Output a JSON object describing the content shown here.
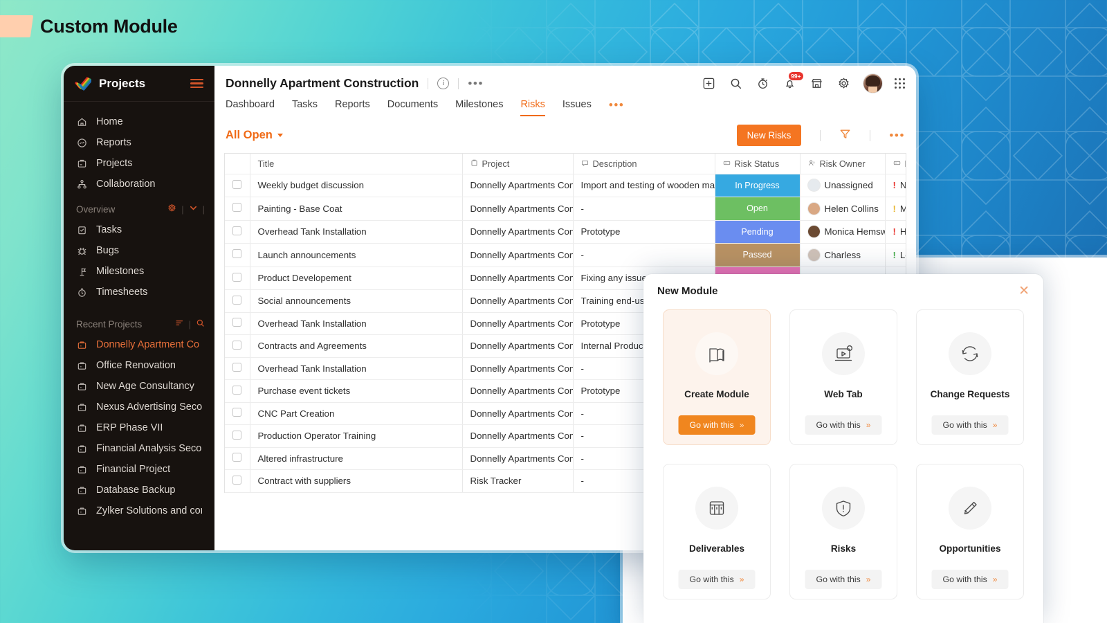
{
  "headline": {
    "text": "Custom Module"
  },
  "sidebar": {
    "brand": "Projects",
    "primary_items": [
      {
        "label": "Home",
        "icon": "home-icon"
      },
      {
        "label": "Reports",
        "icon": "reports-icon"
      },
      {
        "label": "Projects",
        "icon": "projects-icon"
      },
      {
        "label": "Collaboration",
        "icon": "collaboration-icon"
      }
    ],
    "overview": {
      "label": "Overview",
      "settings_icon": "gear-icon",
      "chevron_icon": "chevron-down-icon"
    },
    "overview_items": [
      {
        "label": "Tasks",
        "icon": "tasks-icon"
      },
      {
        "label": "Bugs",
        "icon": "bug-icon"
      },
      {
        "label": "Milestones",
        "icon": "milestone-icon"
      },
      {
        "label": "Timesheets",
        "icon": "timer-icon"
      }
    ],
    "recent": {
      "label": "Recent Projects",
      "sort_icon": "sort-icon",
      "search_icon": "search-icon"
    },
    "recent_projects": [
      {
        "label": "Donnelly Apartment Co",
        "active": true
      },
      {
        "label": "Office Renovation",
        "active": false
      },
      {
        "label": "New Age Consultancy",
        "active": false
      },
      {
        "label": "Nexus Advertising Seco",
        "active": false
      },
      {
        "label": "ERP Phase VII",
        "active": false
      },
      {
        "label": "Financial Analysis Secon",
        "active": false
      },
      {
        "label": "Financial  Project",
        "active": false
      },
      {
        "label": "Database Backup",
        "active": false
      },
      {
        "label": "Zylker Solutions and con",
        "active": false
      }
    ]
  },
  "header": {
    "project_title": "Donnelly Apartment Construction",
    "info_icon": "info-icon",
    "more_icon": "more-horizontal-icon",
    "tabs": [
      {
        "label": "Dashboard",
        "active": false
      },
      {
        "label": "Tasks",
        "active": false
      },
      {
        "label": "Reports",
        "active": false
      },
      {
        "label": "Documents",
        "active": false
      },
      {
        "label": "Milestones",
        "active": false
      },
      {
        "label": "Risks",
        "active": true
      },
      {
        "label": "Issues",
        "active": false
      }
    ],
    "tabs_more_icon": "more-horizontal-icon",
    "actions": [
      {
        "icon": "add-box-icon",
        "name": "add-button"
      },
      {
        "icon": "search-icon",
        "name": "search-button"
      },
      {
        "icon": "timer-icon",
        "name": "timer-button"
      },
      {
        "icon": "bell-icon",
        "name": "notifications-button",
        "badge": "99+"
      },
      {
        "icon": "marketplace-icon",
        "name": "marketplace-button"
      },
      {
        "icon": "gear-icon",
        "name": "settings-button"
      }
    ],
    "avatar_name": "user-avatar",
    "apps_icon": "apps-grid-icon"
  },
  "toolbar": {
    "view_filter": "All Open",
    "new_button": "New Risks",
    "filter_icon": "funnel-icon",
    "more_icon": "more-horizontal-icon"
  },
  "table": {
    "columns": [
      {
        "key": "title",
        "label": "Title",
        "icon": ""
      },
      {
        "key": "project",
        "label": "Project",
        "icon": "clipboard-icon"
      },
      {
        "key": "description",
        "label": "Description",
        "icon": "comment-icon"
      },
      {
        "key": "status",
        "label": "Risk Status",
        "icon": "tag-icon"
      },
      {
        "key": "owner",
        "label": "Risk Owner",
        "icon": "user-group-icon"
      },
      {
        "key": "priority",
        "label": "P",
        "icon": "tag-icon"
      }
    ],
    "add_column_icon": "add-column-icon",
    "rows": [
      {
        "title": "Weekly budget discussion",
        "project": "Donnelly Apartments Cons",
        "description": "Import and testing of wooden mat",
        "status": "In Progress",
        "status_color": "#36a9e1",
        "owner": "Unassigned",
        "owner_color": "#e6eaee",
        "priority": "None",
        "priority_color": "#e8352e"
      },
      {
        "title": "Painting - Base Coat",
        "project": "Donnelly Apartments Cons",
        "description": "-",
        "status": "Open",
        "status_color": "#6dbf62",
        "owner": "Helen Collins",
        "owner_color": "#d9a884",
        "priority": "Medium",
        "priority_color": "#e8b52e"
      },
      {
        "title": "Overhead Tank Installation",
        "project": "Donnelly Apartments Cons",
        "description": "Prototype",
        "status": "Pending",
        "status_color": "#6a8df0",
        "owner": "Monica Hemsw",
        "owner_color": "#6b4a32",
        "priority": "High",
        "priority_color": "#e8352e"
      },
      {
        "title": "Launch announcements",
        "project": "Donnelly Apartments Cons",
        "description": "-",
        "status": "Passed",
        "status_color": "#b99263",
        "owner": "Charless",
        "owner_color": "#cfc2b8",
        "priority": "Low",
        "priority_color": "#4caf50"
      },
      {
        "title": "Product Developement",
        "project": "Donnelly Apartments Cons",
        "description": "Fixing any issues for",
        "status": "",
        "status_color": "#ed74b7",
        "owner": "",
        "owner_color": "#4a4a4a",
        "priority": "",
        "priority_color": "#999999"
      },
      {
        "title": "Social announcements",
        "project": "Donnelly Apartments Cons",
        "description": "Training end-user t",
        "status": "",
        "status_color": "",
        "owner": "",
        "owner_color": "",
        "priority": "",
        "priority_color": ""
      },
      {
        "title": "Overhead Tank Installation",
        "project": "Donnelly Apartments Cons",
        "description": "Prototype",
        "status": "",
        "status_color": "",
        "owner": "",
        "owner_color": "",
        "priority": "",
        "priority_color": ""
      },
      {
        "title": "Contracts and Agreements",
        "project": "Donnelly Apartments Cons",
        "description": "Internal Product or",
        "status": "",
        "status_color": "",
        "owner": "",
        "owner_color": "",
        "priority": "",
        "priority_color": ""
      },
      {
        "title": "Overhead Tank Installation",
        "project": "Donnelly Apartments Cons",
        "description": "-",
        "status": "",
        "status_color": "",
        "owner": "",
        "owner_color": "",
        "priority": "",
        "priority_color": ""
      },
      {
        "title": "Purchase event tickets",
        "project": "Donnelly Apartments Cons",
        "description": "Prototype",
        "status": "",
        "status_color": "",
        "owner": "",
        "owner_color": "",
        "priority": "",
        "priority_color": ""
      },
      {
        "title": "CNC Part Creation",
        "project": "Donnelly Apartments Cons",
        "description": "-",
        "status": "",
        "status_color": "",
        "owner": "",
        "owner_color": "",
        "priority": "",
        "priority_color": ""
      },
      {
        "title": "Production Operator Training",
        "project": "Donnelly Apartments Cons",
        "description": "-",
        "status": "",
        "status_color": "",
        "owner": "",
        "owner_color": "",
        "priority": "",
        "priority_color": ""
      },
      {
        "title": "Altered infrastructure",
        "project": "Donnelly Apartments Cons",
        "description": "-",
        "status": "",
        "status_color": "",
        "owner": "",
        "owner_color": "",
        "priority": "",
        "priority_color": ""
      },
      {
        "title": "Contract with suppliers",
        "project": "Risk Tracker",
        "description": "-",
        "status": "",
        "status_color": "",
        "owner": "",
        "owner_color": "",
        "priority": "",
        "priority_color": ""
      }
    ]
  },
  "modal": {
    "title": "New Module",
    "close_icon": "close-icon",
    "go_label": "Go with this",
    "cards": [
      {
        "label": "Create Module",
        "icon": "book-icon",
        "selected": true
      },
      {
        "label": "Web Tab",
        "icon": "webtab-icon",
        "selected": false
      },
      {
        "label": "Change Requests",
        "icon": "refresh-icon",
        "selected": false
      },
      {
        "label": "Deliverables",
        "icon": "deliverables-icon",
        "selected": false
      },
      {
        "label": "Risks",
        "icon": "shield-alert-icon",
        "selected": false
      },
      {
        "label": "Opportunities",
        "icon": "opportunity-icon",
        "selected": false
      }
    ]
  },
  "colors": {
    "accent_orange": "#f47521",
    "sidebar_bg": "#17120f",
    "bg_gradient_from": "#8fe8c8",
    "bg_gradient_to": "#1a68aa"
  }
}
